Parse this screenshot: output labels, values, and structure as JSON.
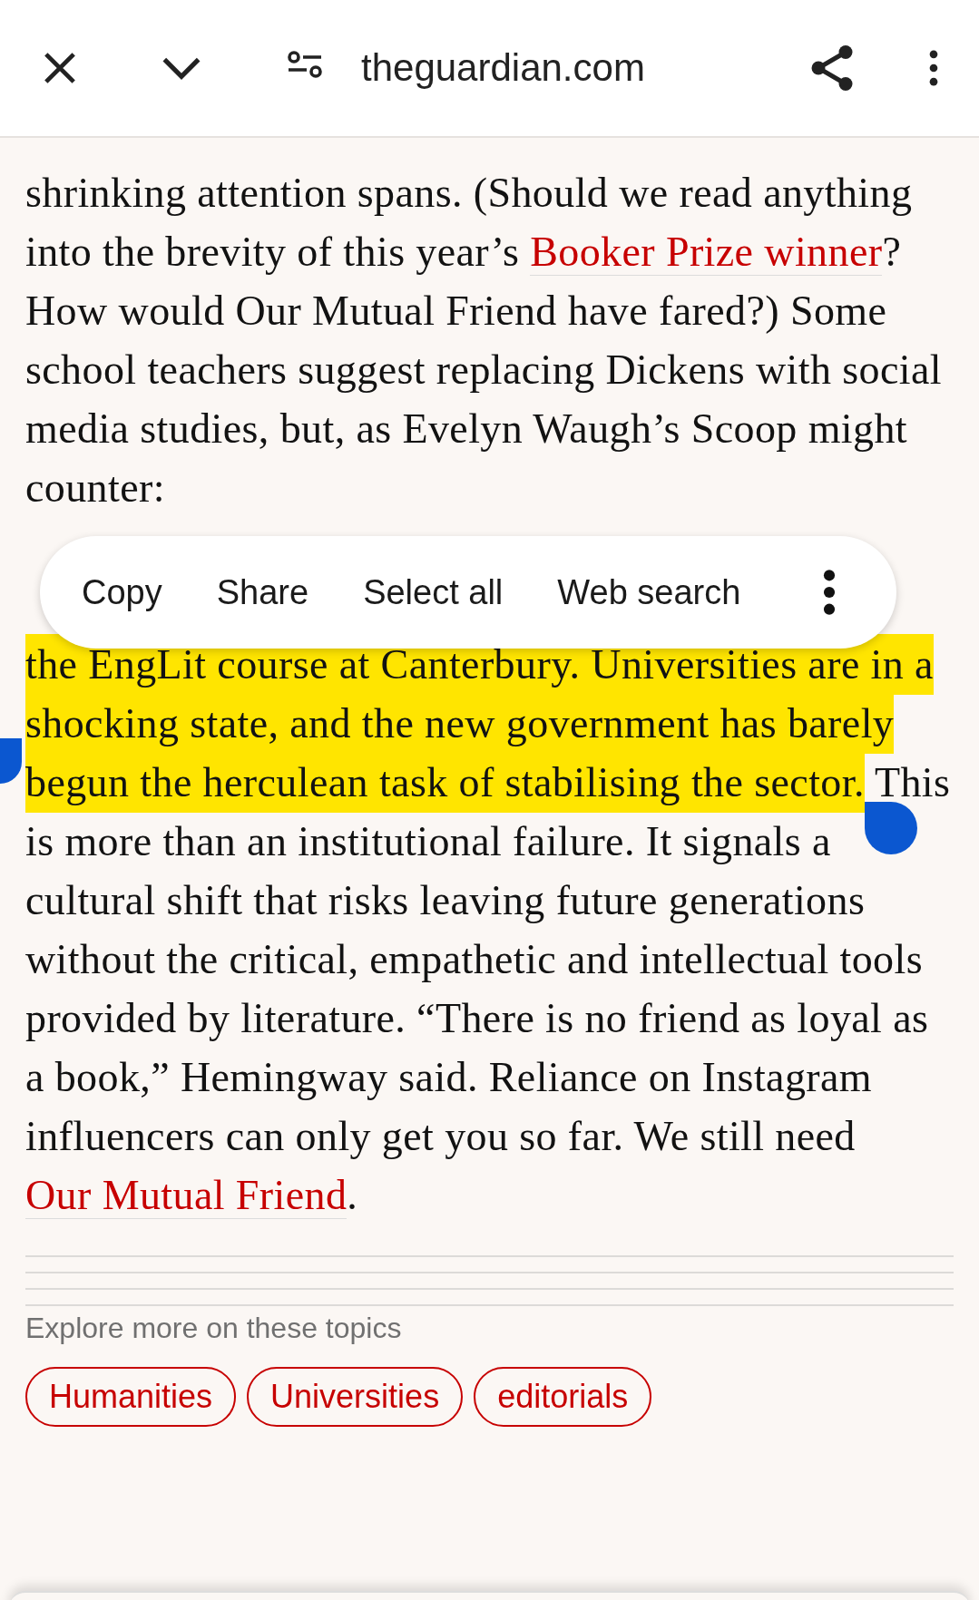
{
  "toolbar": {
    "url": "theguardian.com"
  },
  "paragraphs": [
    {
      "segments": [
        {
          "kind": "text",
          "text": "shrinking attention spans. (Should we read anything into the brevity of this year’s ",
          "highlighted": false
        },
        {
          "kind": "link",
          "text": "Booker Prize winner",
          "highlighted": false
        },
        {
          "kind": "text",
          "text": "? How would Our Mutual Friend have fared?) Some school teachers suggest replacing Dickens with social media studies, but, as Evelyn Waugh’s Scoop might counter:",
          "highlighted": false
        }
      ]
    },
    {
      "segments": [
        {
          "kind": "text",
          "text": "the EngLit course at Canterbury. Universities are in a shocking state, and the new government has barely begun the herculean task of stabilising the sector.",
          "highlighted": true
        },
        {
          "kind": "text",
          "text": " This is more than an institutional failure. It signals a cultural shift that risks leaving future generations without the critical, empathetic and intellectual tools provided by literature. “There is no friend as loyal as a book,” Hemingway said. Reliance on Instagram influencers can only get you so far. We still need ",
          "highlighted": false
        },
        {
          "kind": "link",
          "text": "Our Mutual Friend",
          "highlighted": false
        },
        {
          "kind": "text",
          "text": ".",
          "highlighted": false
        }
      ]
    }
  ],
  "selection_menu": {
    "items": [
      "Copy",
      "Share",
      "Select all",
      "Web search"
    ]
  },
  "topics": {
    "heading": "Explore more on these topics",
    "tags": [
      "Humanities",
      "Universities",
      "editorials"
    ]
  }
}
